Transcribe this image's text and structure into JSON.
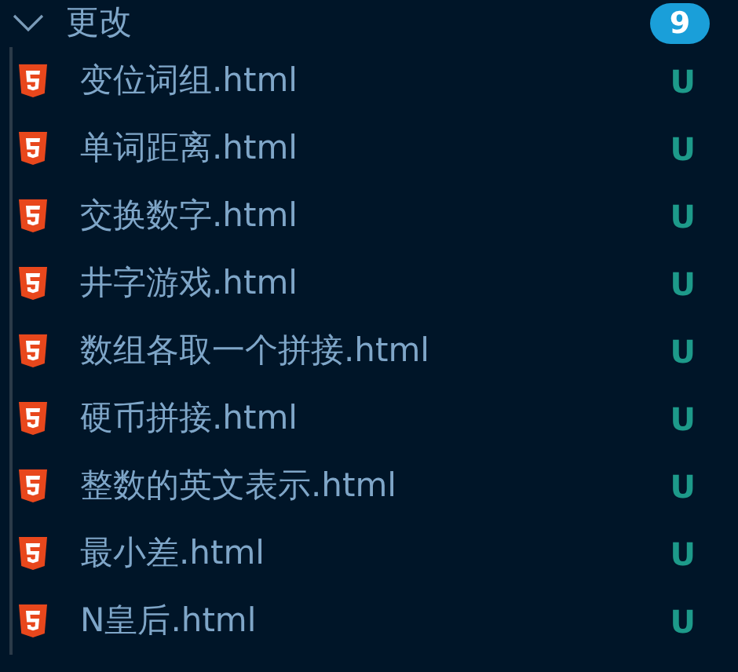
{
  "section": {
    "title": "更改",
    "count": "9",
    "expanded": true
  },
  "files": [
    {
      "name": "变位词组.html",
      "status": "U"
    },
    {
      "name": "单词距离.html",
      "status": "U"
    },
    {
      "name": "交换数字.html",
      "status": "U"
    },
    {
      "name": "井字游戏.html",
      "status": "U"
    },
    {
      "name": "数组各取一个拼接.html",
      "status": "U"
    },
    {
      "name": "硬币拼接.html",
      "status": "U"
    },
    {
      "name": "整数的英文表示.html",
      "status": "U"
    },
    {
      "name": "最小差.html",
      "status": "U"
    },
    {
      "name": "N皇后.html",
      "status": "U"
    }
  ]
}
